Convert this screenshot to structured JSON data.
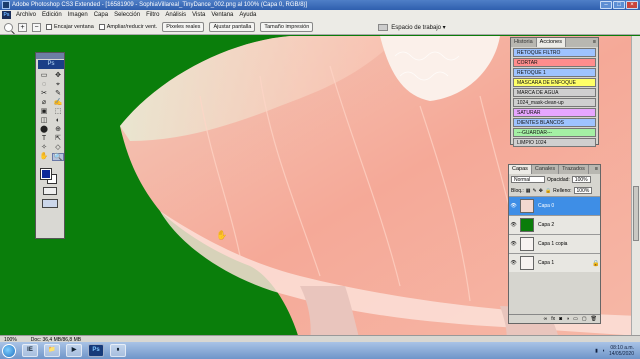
{
  "titlebar": {
    "title": "Adobe Photoshop CS3 Extended - [16581909 - SophiaVillareal_TinyDance_002.png al 100% (Capa 0, RGB/8)]"
  },
  "menubar": {
    "items": [
      "Archivo",
      "Edición",
      "Imagen",
      "Capa",
      "Selección",
      "Filtro",
      "Análisis",
      "Vista",
      "Ventana",
      "Ayuda"
    ],
    "workspace_label": "Espacio de trabajo"
  },
  "options": {
    "fit_window": "Encajar ventana",
    "zoom_resize": "Ampliar/reducir vent.",
    "actual_pixels": "Pixeles reales",
    "fit_screen": "Ajustar pantalla",
    "print_size": "Tamaño impresión",
    "workspace": "Espacio de trabajo ▾"
  },
  "tools_panel": {
    "badge": "Ps",
    "tools": [
      "▭",
      "✥",
      "◌",
      "⌖",
      "✂",
      "✎",
      "⌀",
      "✍",
      "▣",
      "⬚",
      "◫",
      "◐",
      "⬤",
      "⊕",
      "T",
      "⇱",
      "✧",
      "◇",
      "✋",
      "🔍"
    ]
  },
  "actions_panel": {
    "tabs": [
      "Historia",
      "Acciones"
    ],
    "rows": [
      {
        "label": "RETOQUE FILTRO",
        "color": "#9ec3ff"
      },
      {
        "label": "CORTAR",
        "color": "#ff8d8d"
      },
      {
        "label": "RETOQUE 1",
        "color": "#9ec3ff"
      },
      {
        "label": "MASCARA DE ENFOQUE",
        "color": "#ffff66"
      },
      {
        "label": "MARCA DE AGUA",
        "color": "#cfcfcf"
      },
      {
        "label": "1024_mask-clean-up",
        "color": "#cfcfcf"
      },
      {
        "label": "SATURAR",
        "color": "#e6a6ff"
      },
      {
        "label": "DIENTES BLANCOS",
        "color": "#9ec3ff"
      },
      {
        "label": "---GUARDAR---",
        "color": "#a4f0a4"
      },
      {
        "label": "LIMPIO 1024",
        "color": "#cfcfcf"
      }
    ]
  },
  "layers_panel": {
    "tabs": [
      "Capas",
      "Canales",
      "Trazados"
    ],
    "blend_mode": "Normal",
    "opacity_label": "Opacidad:",
    "opacity_value": "100%",
    "lock_label": "Bloq.:",
    "fill_label": "Relleno:",
    "fill_value": "100%",
    "layers": [
      {
        "name": "Capa 0",
        "active": true,
        "thumb": "#f3d8d0"
      },
      {
        "name": "Capa 2",
        "active": false,
        "thumb": "#0a7d0a"
      },
      {
        "name": "Capa 1 copia",
        "active": false,
        "thumb": "#f7f3f1"
      },
      {
        "name": "Capa 1",
        "active": false,
        "thumb": "#f7f3f1"
      }
    ]
  },
  "status": {
    "zoom": "100%",
    "doc": "Doc: 36,4 MB/86,8 MB"
  },
  "taskbar": {
    "time": "08:10 a.m.",
    "date": "14/05/2020",
    "apps": [
      "IE",
      "📁",
      "▶",
      "Ps",
      "⏸"
    ]
  }
}
